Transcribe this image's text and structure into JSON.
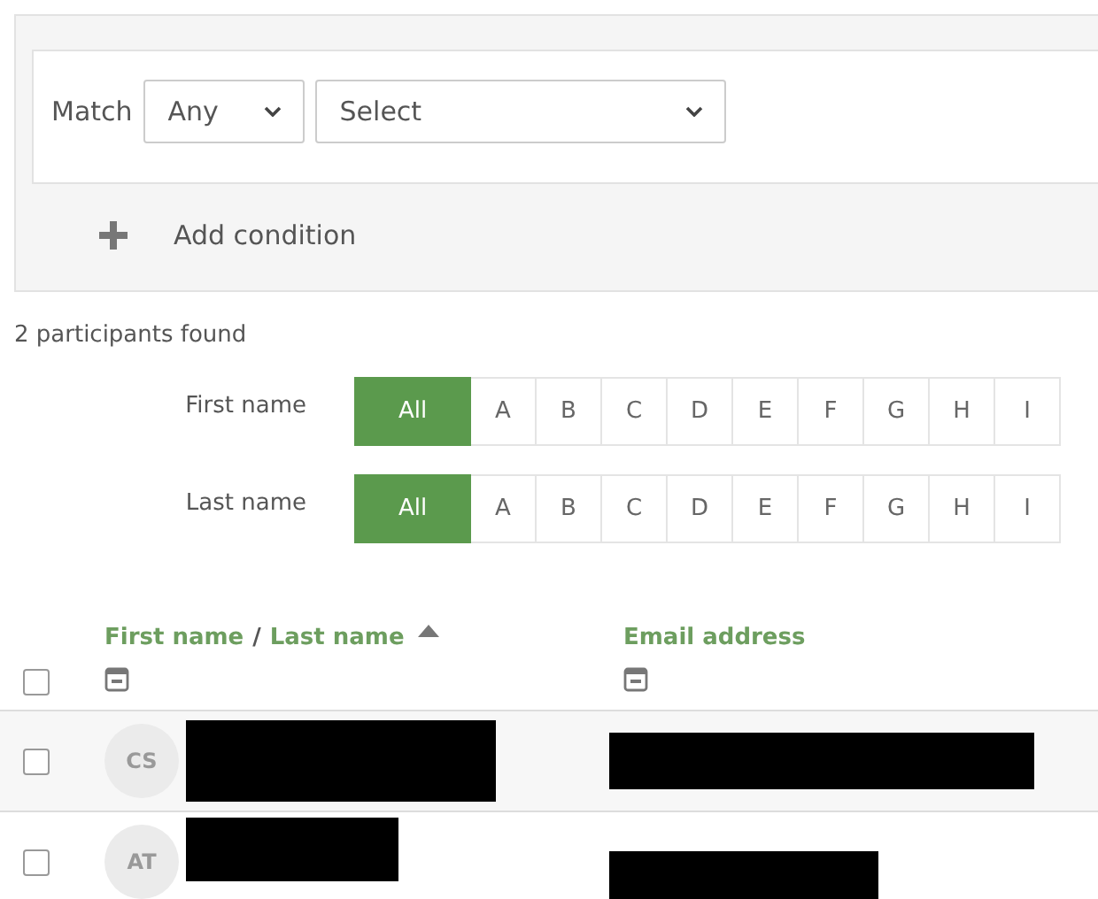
{
  "filter": {
    "match_label": "Match",
    "match_select": {
      "value": "Any"
    },
    "field_select": {
      "value": "Select"
    },
    "add_condition": "Add condition"
  },
  "result_count": "2 participants found",
  "initials_bars": [
    {
      "label": "First name",
      "options": [
        {
          "label": "All",
          "selected": true
        },
        {
          "label": "A",
          "selected": false
        },
        {
          "label": "B",
          "selected": false
        },
        {
          "label": "C",
          "selected": false
        },
        {
          "label": "D",
          "selected": false
        },
        {
          "label": "E",
          "selected": false
        },
        {
          "label": "F",
          "selected": false
        },
        {
          "label": "G",
          "selected": false
        },
        {
          "label": "H",
          "selected": false
        },
        {
          "label": "I",
          "selected": false
        }
      ]
    },
    {
      "label": "Last name",
      "options": [
        {
          "label": "All",
          "selected": true
        },
        {
          "label": "A",
          "selected": false
        },
        {
          "label": "B",
          "selected": false
        },
        {
          "label": "C",
          "selected": false
        },
        {
          "label": "D",
          "selected": false
        },
        {
          "label": "E",
          "selected": false
        },
        {
          "label": "F",
          "selected": false
        },
        {
          "label": "G",
          "selected": false
        },
        {
          "label": "H",
          "selected": false
        },
        {
          "label": "I",
          "selected": false
        }
      ]
    }
  ],
  "table": {
    "header": {
      "select_all_checked": false,
      "name_sort_first": "First name",
      "name_sort_separator": "/",
      "name_sort_last": "Last name",
      "email": "Email address"
    },
    "rows": [
      {
        "checked": false,
        "initials": "CS",
        "redacted": true
      },
      {
        "checked": false,
        "initials": "AT",
        "redacted": true
      }
    ]
  }
}
